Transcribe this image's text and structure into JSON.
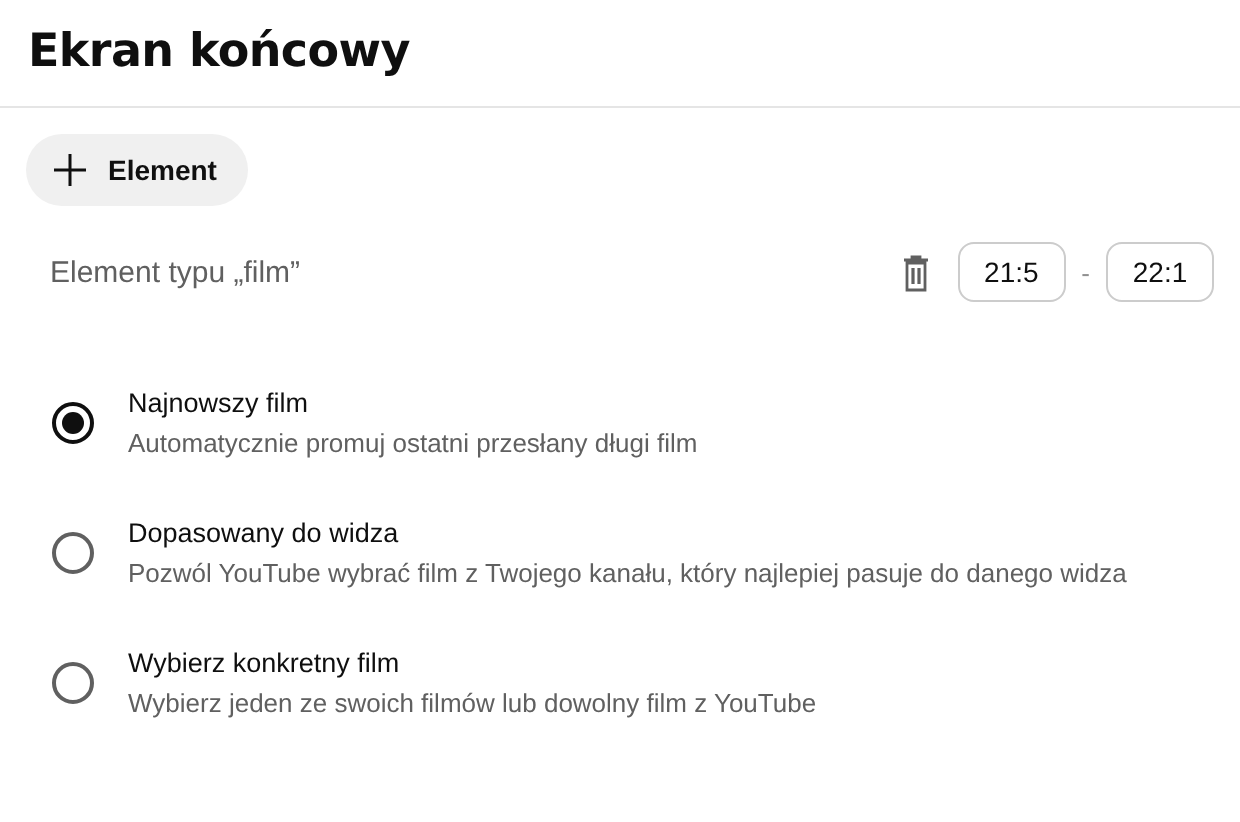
{
  "header": {
    "title": "Ekran końcowy"
  },
  "add_button": {
    "label": "Element"
  },
  "element": {
    "label": "Element typu „film”",
    "start_time": "21:5",
    "end_time": "22:1",
    "separator": "-"
  },
  "options": [
    {
      "title": "Najnowszy film",
      "description": "Automatycznie promuj ostatni przesłany długi film",
      "selected": true
    },
    {
      "title": "Dopasowany do widza",
      "description": "Pozwól YouTube wybrać film z Twojego kanału, który najlepiej pasuje do danego widza",
      "selected": false
    },
    {
      "title": "Wybierz konkretny film",
      "description": "Wybierz jeden ze swoich filmów lub dowolny film z YouTube",
      "selected": false
    }
  ]
}
